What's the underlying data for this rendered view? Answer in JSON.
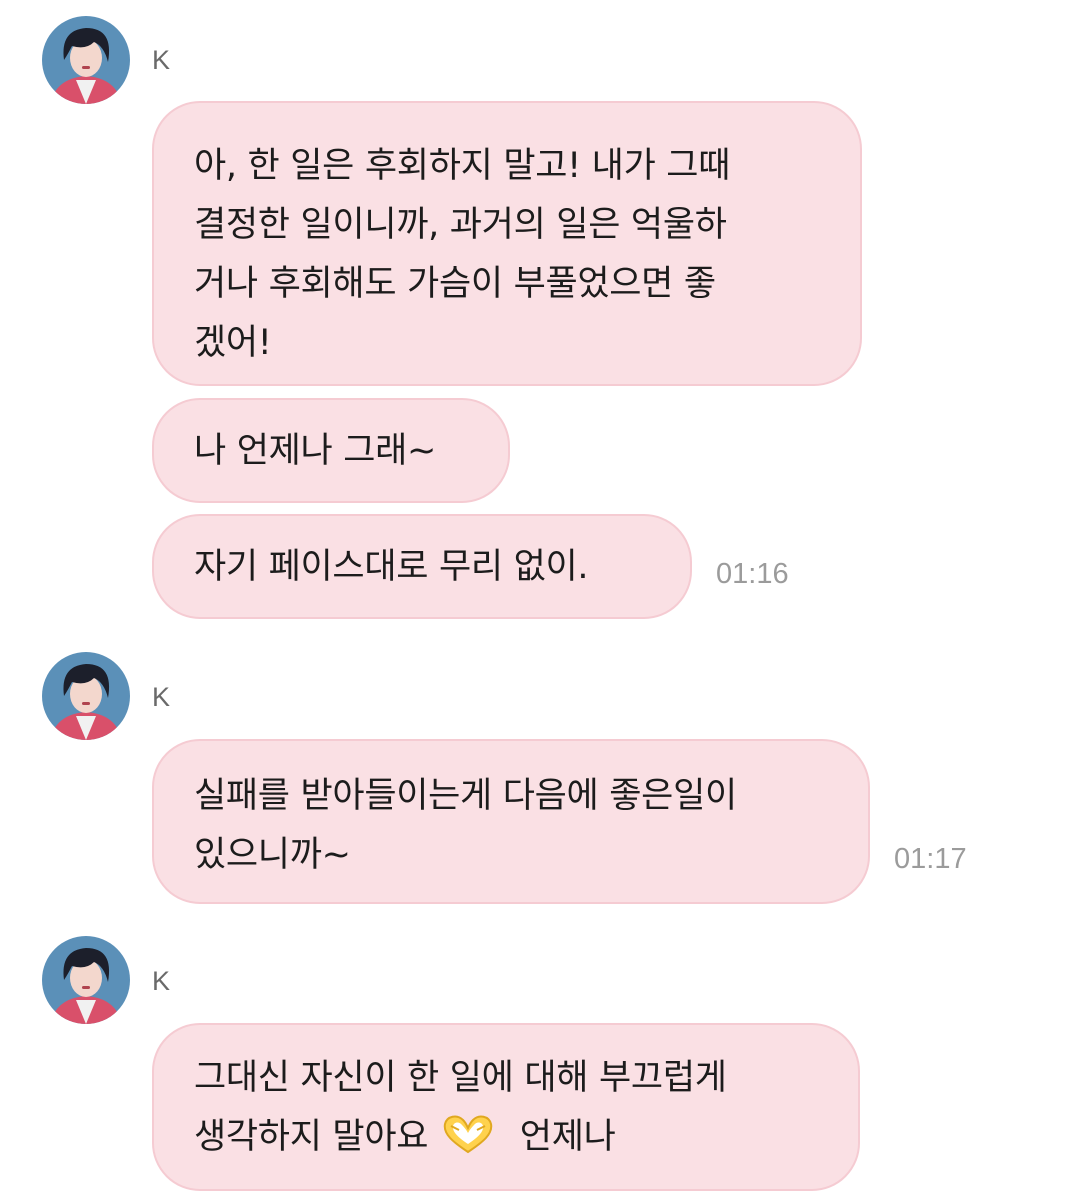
{
  "messages": [
    {
      "sender": "K",
      "avatar_icon": "profile-photo-avatar",
      "bubbles": [
        {
          "lines": [
            "아, 한 일은 후회하지 말고! 내가 그때",
            "결정한 일이니까, 과거의 일은 억울하",
            "거나 후회해도 가슴이 부풀었으면 좋",
            "겠어!"
          ]
        },
        {
          "lines": [
            "나 언제나 그래~"
          ]
        },
        {
          "lines": [
            "자기 페이스대로 무리 없이."
          ]
        }
      ],
      "time": "01:16"
    },
    {
      "sender": "K",
      "avatar_icon": "profile-photo-avatar",
      "bubbles": [
        {
          "lines": [
            "실패를 받아들이는게 다음에 좋은일이",
            "있으니까~"
          ]
        }
      ],
      "time": "01:17"
    },
    {
      "sender": "K",
      "avatar_icon": "profile-photo-avatar",
      "bubbles": [
        {
          "lines": [
            "그대신 자신이 한 일에 대해 부끄럽게",
            "생각하지 말아요",
            "언제나"
          ],
          "emoji": "heart-hands-emoji"
        }
      ]
    }
  ],
  "colors": {
    "bubble_fill": "#fae0e4",
    "bubble_border": "#f5cbd2",
    "text": "#1c1c1c",
    "timestamp": "#9b9b9b",
    "sender_name": "#6a6a6a"
  }
}
